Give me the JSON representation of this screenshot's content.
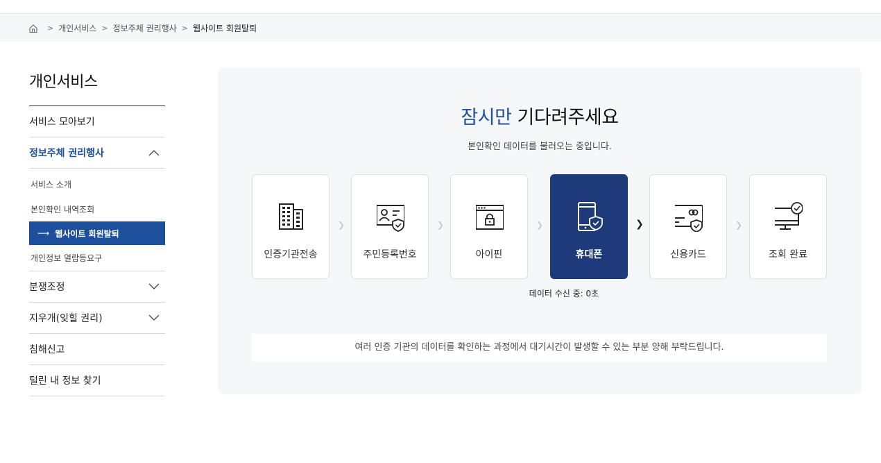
{
  "breadcrumb": {
    "home_icon": "home-icon",
    "items": [
      "개인서비스",
      "정보주체 권리행사",
      "웹사이트 회원탈퇴"
    ]
  },
  "sidebar": {
    "title": "개인서비스",
    "items": [
      {
        "label": "서비스 모아보기"
      },
      {
        "label": "정보주체 권리행사",
        "expanded": true
      },
      {
        "label": "분쟁조정"
      },
      {
        "label": "지우개(잊힐 권리)"
      },
      {
        "label": "침해신고"
      },
      {
        "label": "털린 내 정보 찾기"
      }
    ],
    "subitems": [
      "서비스 소개",
      "본인확인 내역조회",
      "웹사이트 회원탈퇴",
      "개인정보 열람등요구"
    ],
    "active_arrow": "⟶"
  },
  "panel": {
    "title_accent": "잠시만",
    "title_rest": " 기다려주세요",
    "subtitle": "본인확인 데이터를 불러오는 중입니다.",
    "steps": [
      {
        "label": "인증기관전송",
        "icon": "building-icon"
      },
      {
        "label": "주민등록번호",
        "icon": "id-card-shield-icon"
      },
      {
        "label": "아이핀",
        "icon": "browser-lock-icon"
      },
      {
        "label": "휴대폰",
        "icon": "phone-shield-icon",
        "active": true
      },
      {
        "label": "신용카드",
        "icon": "credit-card-shield-icon"
      },
      {
        "label": "조회 완료",
        "icon": "monitor-check-icon"
      }
    ],
    "status": "데이터 수신 중: 0초",
    "notice": "여러 인증 기관의 데이터를 확인하는 과정에서 대기시간이 발생할 수 있는 부분 양해 부탁드립니다."
  },
  "colors": {
    "accent": "#1d4f9c",
    "active_step": "#1e3a7a",
    "panel_bg": "#f6f7f8"
  }
}
